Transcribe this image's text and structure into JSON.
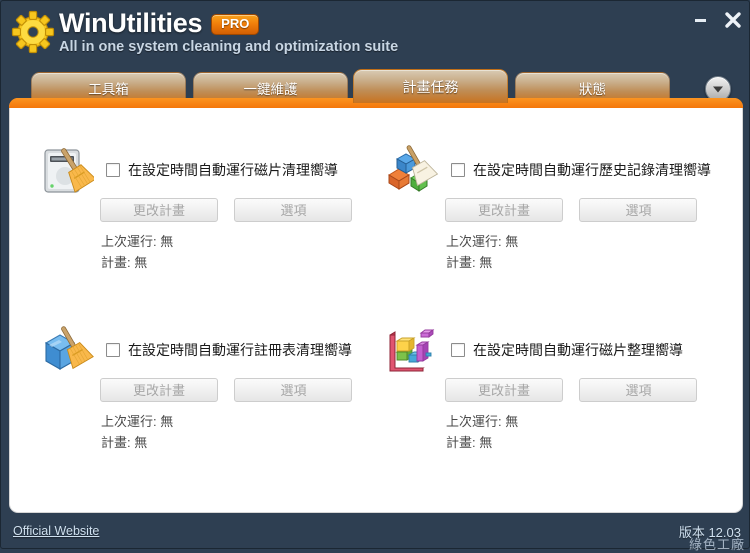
{
  "window": {
    "brand_name": "WinUtilities",
    "pro_badge": "PRO",
    "tagline": "All in one system cleaning and optimization suite",
    "logo_icon": "gear-icon",
    "minimize_icon": "minimize-icon",
    "close_icon": "close-icon"
  },
  "tabs": {
    "more_icon": "chevron-down-icon",
    "items": [
      {
        "label": "工具箱",
        "active": false
      },
      {
        "label": "一鍵維護",
        "active": false
      },
      {
        "label": "計畫任務",
        "active": true
      },
      {
        "label": "狀態",
        "active": false
      }
    ]
  },
  "buttons": {
    "change_schedule": "更改計畫",
    "options": "選項"
  },
  "panels": [
    {
      "icon": "disk-cleanup-icon",
      "checkbox_label": "在設定時間自動運行磁片清理嚮導",
      "checked": false,
      "last_run": "上次運行: 無",
      "schedule": "計畫: 無"
    },
    {
      "icon": "history-cleanup-icon",
      "checkbox_label": "在設定時間自動運行歷史記錄清理嚮導",
      "checked": false,
      "last_run": "上次運行: 無",
      "schedule": "計畫: 無"
    },
    {
      "icon": "registry-cleanup-icon",
      "checkbox_label": "在設定時間自動運行註冊表清理嚮導",
      "checked": false,
      "last_run": "上次運行: 無",
      "schedule": "計畫: 無"
    },
    {
      "icon": "disk-defrag-icon",
      "checkbox_label": "在設定時間自動運行磁片整理嚮導",
      "checked": false,
      "last_run": "上次運行: 無",
      "schedule": "計畫: 無"
    }
  ],
  "footer": {
    "official_website": "Official Website",
    "version": "版本 12.03",
    "watermark": "綠色工廠"
  },
  "colors": {
    "accent_orange": "#f4760a",
    "window_blue": "#4f6a86",
    "panel_white": "#ffffff",
    "pro_badge": "#ef7d0a"
  }
}
